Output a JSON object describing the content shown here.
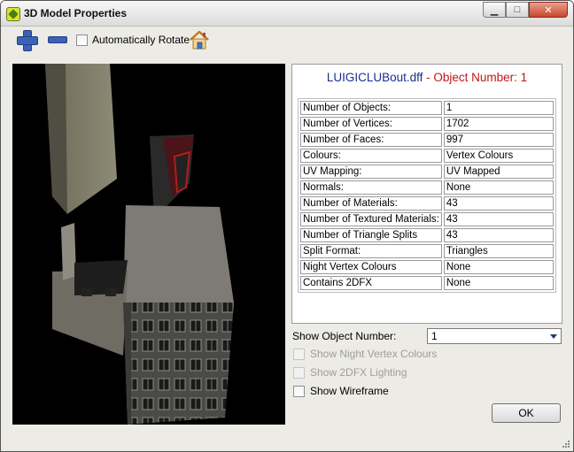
{
  "window": {
    "title": "3D Model Properties"
  },
  "toolbar": {
    "auto_rotate_label": "Automatically Rotate"
  },
  "model": {
    "filename": "LUIGICLUBout.dff",
    "separator": " - ",
    "object_label": "Object Number: 1"
  },
  "properties": [
    {
      "label": "Number of Objects:",
      "value": "1"
    },
    {
      "label": "Number of Vertices:",
      "value": "1702"
    },
    {
      "label": "Number of Faces:",
      "value": "997"
    },
    {
      "label": "Colours:",
      "value": "Vertex Colours"
    },
    {
      "label": "UV Mapping:",
      "value": "UV Mapped"
    },
    {
      "label": "Normals:",
      "value": "None"
    },
    {
      "label": "Number of Materials:",
      "value": "43"
    },
    {
      "label": "Number of Textured Materials:",
      "value": "43"
    },
    {
      "label": "Number of Triangle Splits",
      "value": "43"
    },
    {
      "label": "Split Format:",
      "value": "Triangles"
    },
    {
      "label": "Night Vertex Colours",
      "value": "None"
    },
    {
      "label": "Contains 2DFX",
      "value": "None"
    }
  ],
  "controls": {
    "show_object_label": "Show Object Number:",
    "show_object_value": "1",
    "night_colours_label": "Show Night Vertex Colours",
    "lighting_label": "Show 2DFX Lighting",
    "wireframe_label": "Show Wireframe",
    "ok_label": "OK"
  },
  "colors": {
    "filename": "#1a2d8e",
    "object_number": "#c01616",
    "accent": "#3b62b8"
  }
}
